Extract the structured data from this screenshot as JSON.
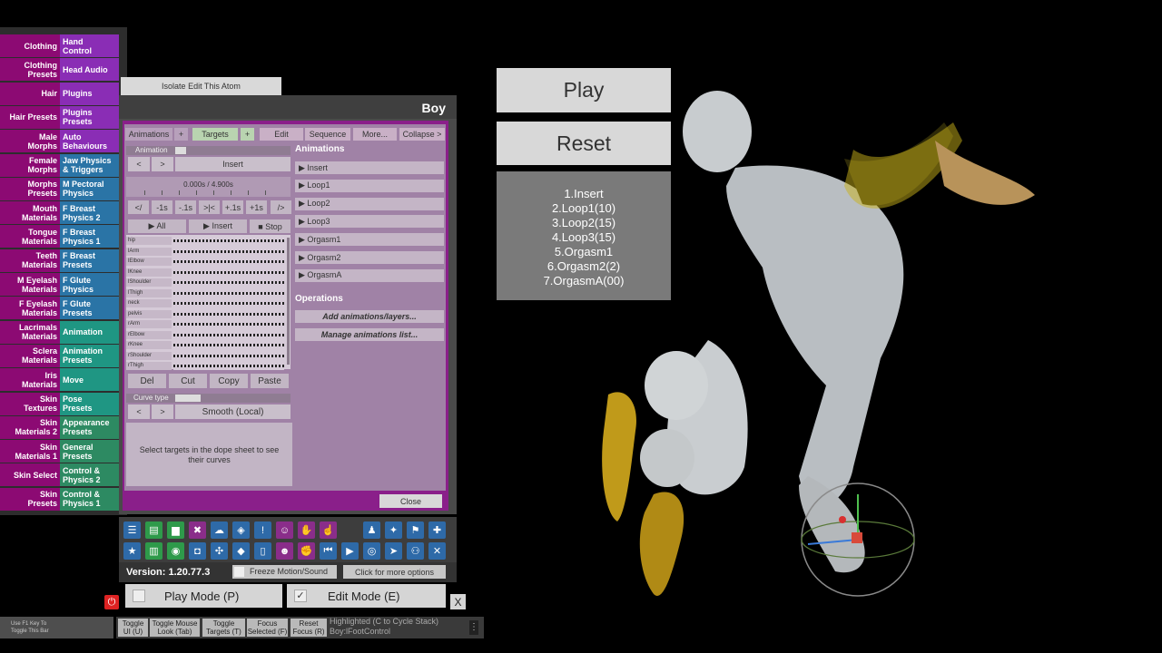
{
  "left_menu": [
    {
      "left": "Clothing",
      "right": "Hand\nControl",
      "rc": "c-purple"
    },
    {
      "left": "Clothing\nPresets",
      "right": "Head Audio",
      "rc": "c-purple"
    },
    {
      "left": "Hair",
      "right": "Plugins",
      "rc": "c-purple"
    },
    {
      "left": "Hair Presets",
      "right": "Plugins\nPresets",
      "rc": "c-purple"
    },
    {
      "left": "Male\nMorphs",
      "right": "Auto\nBehaviours",
      "rc": "c-purple"
    },
    {
      "left": "Female\nMorphs",
      "right": "Jaw Physics\n& Triggers",
      "rc": "c-blue"
    },
    {
      "left": "Morphs\nPresets",
      "right": "M Pectoral\nPhysics",
      "rc": "c-blue"
    },
    {
      "left": "Mouth\nMaterials",
      "right": "F Breast\nPhysics 2",
      "rc": "c-blue"
    },
    {
      "left": "Tongue\nMaterials",
      "right": "F Breast\nPhysics 1",
      "rc": "c-blue"
    },
    {
      "left": "Teeth\nMaterials",
      "right": "F Breast\nPresets",
      "rc": "c-blue"
    },
    {
      "left": "M Eyelash\nMaterials",
      "right": "F Glute\nPhysics",
      "rc": "c-blue"
    },
    {
      "left": "F Eyelash\nMaterials",
      "right": "F Glute\nPresets",
      "rc": "c-blue"
    },
    {
      "left": "Lacrimals\nMaterials",
      "right": "Animation",
      "rc": "c-teal"
    },
    {
      "left": "Sclera\nMaterials",
      "right": "Animation\nPresets",
      "rc": "c-teal"
    },
    {
      "left": "Iris\nMaterials",
      "right": "Move",
      "rc": "c-teal"
    },
    {
      "left": "Skin\nTextures",
      "right": "Pose\nPresets",
      "rc": "c-teal"
    },
    {
      "left": "Skin\nMaterials 2",
      "right": "Appearance\nPresets",
      "rc": "c-green"
    },
    {
      "left": "Skin\nMaterials 1",
      "right": "General\nPresets",
      "rc": "c-green"
    },
    {
      "left": "Skin Select",
      "right": "Control &\nPhysics 2",
      "rc": "c-green"
    },
    {
      "left": "Skin\nPresets",
      "right": "Control &\nPhysics 1",
      "rc": "c-green"
    }
  ],
  "isolate_button": "Isolate Edit This Atom",
  "panel_title": "Boy",
  "tabs": {
    "animations": "Animations",
    "plus1": "+",
    "targets": "Targets",
    "plus2": "+",
    "edit": "Edit",
    "sequence": "Sequence",
    "more": "More...",
    "collapse": "Collapse >"
  },
  "animation_label": "Animation",
  "nav_prev": "<",
  "nav_next": ">",
  "insert_label": "Insert",
  "time_display": "0.000s / 4.900s",
  "step_buttons": [
    "</",
    "-1s",
    "-.1s",
    ">|<",
    "+.1s",
    "+1s",
    "/>"
  ],
  "play_all": "▶ All",
  "play_insert": "▶ Insert",
  "stop": "■ Stop",
  "tracks": [
    "hip",
    "lArm",
    "lElbow",
    "lKnee",
    "lShoulder",
    "lThigh",
    "neck",
    "pelvis",
    "rArm",
    "rElbow",
    "rKnee",
    "rShoulder",
    "rThigh"
  ],
  "edit_buttons": [
    "Del",
    "Cut",
    "Copy",
    "Paste"
  ],
  "curve_type_label": "Curve type",
  "curve_prev": "<",
  "curve_next": ">",
  "curve_value": "Smooth (Local)",
  "curve_hint": "Select targets in the dope sheet to see their curves",
  "animations_header": "Animations",
  "animations": [
    "▶ Insert",
    "▶ Loop1",
    "▶ Loop2",
    "▶ Loop3",
    "▶ Orgasm1",
    "▶ Orgasm2",
    "▶ OrgasmA"
  ],
  "operations_header": "Operations",
  "op_add": "Add animations/layers...",
  "op_manage": "Manage animations list...",
  "close_button": "Close",
  "toolbar_icons_row1": [
    {
      "name": "menu-icon",
      "glyph": "☰",
      "c": "ti-b"
    },
    {
      "name": "open-scene-icon",
      "glyph": "▤",
      "c": "ti-g"
    },
    {
      "name": "folder-icon",
      "glyph": "▆",
      "c": "ti-g"
    },
    {
      "name": "delete-icon",
      "glyph": "✖",
      "c": "ti-p"
    },
    {
      "name": "cloud-icon",
      "glyph": "☁",
      "c": "ti-b"
    },
    {
      "name": "box-icon",
      "glyph": "◈",
      "c": "ti-b"
    },
    {
      "name": "alert-icon",
      "glyph": "!",
      "c": "ti-b"
    },
    {
      "name": "person-add-icon",
      "glyph": "☺",
      "c": "ti-p"
    },
    {
      "name": "hand-icon",
      "glyph": "✋",
      "c": "ti-p"
    },
    {
      "name": "pointer-icon",
      "glyph": "☝",
      "c": "ti-p"
    },
    {
      "name": "person-icon",
      "glyph": "♟",
      "c": "ti-b"
    },
    {
      "name": "unity-icon",
      "glyph": "✦",
      "c": "ti-b"
    },
    {
      "name": "flag-icon",
      "glyph": "⚑",
      "c": "ti-b"
    },
    {
      "name": "plus-icon",
      "glyph": "✚",
      "c": "ti-b"
    }
  ],
  "toolbar_icons_row2": [
    {
      "name": "star-icon",
      "glyph": "★",
      "c": "ti-b"
    },
    {
      "name": "save-icon",
      "glyph": "▥",
      "c": "ti-g"
    },
    {
      "name": "screenshot-icon",
      "glyph": "◉",
      "c": "ti-g"
    },
    {
      "name": "camera-icon",
      "glyph": "◘",
      "c": "ti-b"
    },
    {
      "name": "network-icon",
      "glyph": "✣",
      "c": "ti-b"
    },
    {
      "name": "package-icon",
      "glyph": "◆",
      "c": "ti-b"
    },
    {
      "name": "document-icon",
      "glyph": "▯",
      "c": "ti-b"
    },
    {
      "name": "person-edit-icon",
      "glyph": "☻",
      "c": "ti-p"
    },
    {
      "name": "hand-grab-icon",
      "glyph": "✊",
      "c": "ti-p"
    },
    {
      "name": "skip-back-icon",
      "glyph": "⏮",
      "c": "ti-b"
    },
    {
      "name": "play-icon",
      "glyph": "▶",
      "c": "ti-b"
    },
    {
      "name": "target-icon",
      "glyph": "◎",
      "c": "ti-b"
    },
    {
      "name": "cursor-icon",
      "glyph": "➤",
      "c": "ti-b"
    },
    {
      "name": "people-icon",
      "glyph": "⚇",
      "c": "ti-b"
    },
    {
      "name": "tools-icon",
      "glyph": "✕",
      "c": "ti-b"
    }
  ],
  "version": "Version: 1.20.77.3",
  "freeze_motion": "Freeze Motion/Sound",
  "more_options": "Click for more options",
  "play_mode": "Play Mode (P)",
  "edit_mode": "Edit Mode (E)",
  "close_x": "X",
  "f1_hint": "Use F1 Key To\nToggle This Bar",
  "bottom_buttons": [
    "Toggle\nUI (U)",
    "Toggle Mouse\nLook (Tab)",
    "Toggle\nTargets (T)",
    "Focus\nSelected (F)",
    "Reset\nFocus (R)"
  ],
  "highlighted_text": "Highlighted (C to Cycle Stack)",
  "highlighted_value": "Boy:lFootControl",
  "scene_play": "Play",
  "scene_reset": "Reset",
  "scene_list": [
    "1.Insert",
    "2.Loop1(10)",
    "3.Loop2(15)",
    "4.Loop3(15)",
    "5.Orgasm1",
    "6.Orgasm2(2)",
    "7.OrgasmA(00)"
  ],
  "colors": {
    "menu_magenta": "#8c0a73",
    "panel_purple": "#8a1f8a",
    "plugin_bg": "#a082a6"
  }
}
